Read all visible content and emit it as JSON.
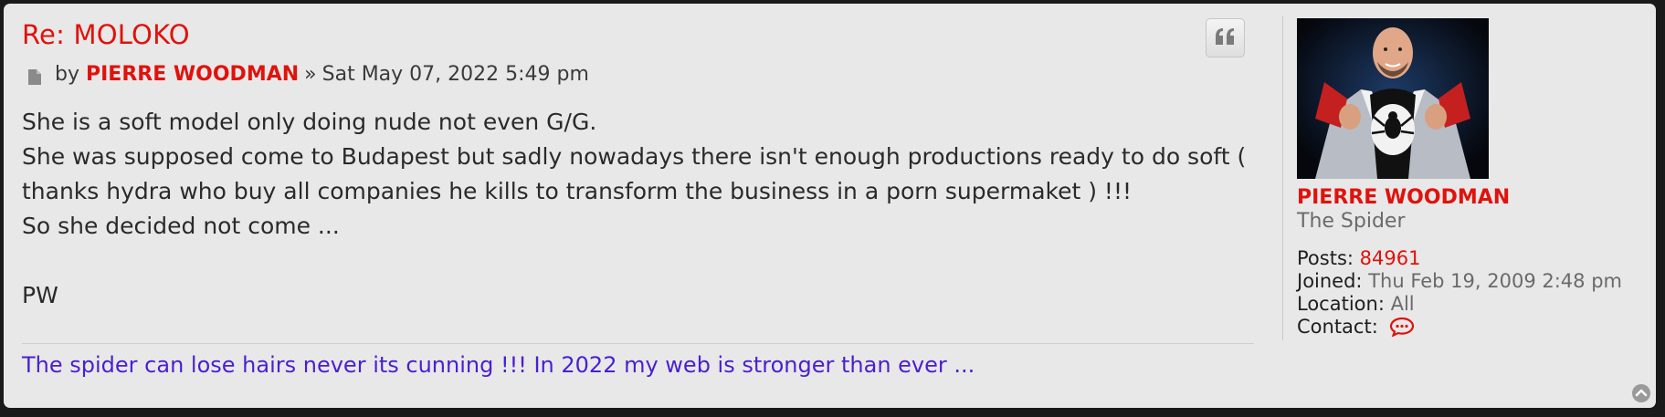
{
  "post": {
    "title": "Re: MOLOKO",
    "by_label": "by",
    "author": "PIERRE WOODMAN",
    "separator": "»",
    "date": "Sat May 07, 2022 5:49 pm",
    "content_lines": [
      "She is a soft model only doing nude not even G/G.",
      "She was supposed come to Budapest but sadly nowadays there isn't enough productions ready to do soft (",
      "thanks hydra who buy all companies he kills to transform the business in a porn supermaket ) !!!",
      "So she decided not come ...",
      "",
      "PW"
    ],
    "signature": "The spider can lose hairs never its cunning !!! In 2022 my web is stronger than ever ..."
  },
  "profile": {
    "username": "PIERRE WOODMAN",
    "rank": "The Spider",
    "posts_label": "Posts:",
    "posts_value": "84961",
    "joined_label": "Joined:",
    "joined_value": "Thu Feb 19, 2009 2:48 pm",
    "location_label": "Location:",
    "location_value": "All",
    "contact_label": "Contact:"
  },
  "icons": {
    "post": "document-icon",
    "quote": "quote-icon",
    "contact": "speech-bubble-icon",
    "back_to_top": "chevron-up-circle-icon"
  },
  "colors": {
    "accent_red": "#e0120c",
    "signature_purple": "#4a1fd0",
    "panel_bg": "#e8e8e8",
    "page_bg": "#1a1a1a"
  }
}
